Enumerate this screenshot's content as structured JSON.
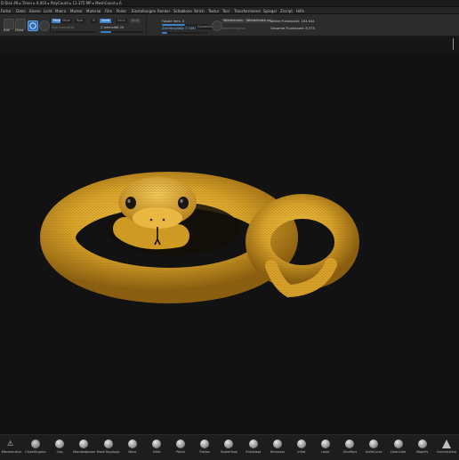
{
  "title_strip": "D Disk 49 ▸ Timer ▸ 0.003 ▸ PolyCount ▸ 13.375 MP ▸ MeshCount ▸ 6",
  "menu": [
    "Farbe",
    "Datei",
    "Ebene",
    "Licht",
    "Makro",
    "Marker",
    "Material",
    "Film",
    "Polier",
    "Einstellungen",
    "Render",
    "Schablone",
    "Strich",
    "Textur",
    "Tool",
    "Transformieren",
    "Spiegel",
    "Zscript",
    "Hilfe"
  ],
  "toolshelf": {
    "buttons": [
      {
        "label": "Edit"
      },
      {
        "label": "Draw"
      },
      {
        "label": ""
      }
    ],
    "mode_chips": {
      "mrgb": "Mrgb",
      "rgb": "Rgb",
      "m": "M",
      "zadd": "Zadd",
      "zsub": "Zsub",
      "zcut": "Zcut"
    },
    "rgb_intensity_label": "Rgb Intensität",
    "z_intensity_label": "Z Intensität 25",
    "focal_shift_label": "Fokale Vers. 0",
    "draw_size_label": "Zeichengröße 7.74939",
    "dynamic_label": "Dynamisch",
    "repeat_buttons": {
      "wiederholen": "Wiederholen",
      "wiederholen_zu": "Wiederholen zu"
    },
    "replay_hint": "Letzte Relative",
    "active_points": "Aktive Punktezahl: 163.444",
    "total_points": "Gesamte Punktezahl: 8.373",
    "z_intensity_value": 25,
    "colors": {
      "accent": "#3d82c8",
      "panel": "#2c2c2c"
    }
  },
  "brushes": [
    {
      "label": "Mikrostruktur",
      "icon": "warning-icon"
    },
    {
      "label": "ChiselOrganic",
      "icon": "organic-icon"
    },
    {
      "label": "Clay",
      "icon": "sphere-icon"
    },
    {
      "label": "Standardpinsel",
      "icon": "sphere-icon"
    },
    {
      "label": "Move Topologic",
      "icon": "sphere-icon"
    },
    {
      "label": "Move",
      "icon": "sphere-icon"
    },
    {
      "label": "Inflat",
      "icon": "sphere-icon"
    },
    {
      "label": "Polish",
      "icon": "sphere-icon"
    },
    {
      "label": "Flatten",
      "icon": "sphere-icon"
    },
    {
      "label": "SnakeHook",
      "icon": "sphere-icon"
    },
    {
      "label": "TrimAdapt",
      "icon": "sphere-icon"
    },
    {
      "label": "TrimLasso",
      "icon": "sphere-icon"
    },
    {
      "label": "Inflat",
      "icon": "sphere-icon"
    },
    {
      "label": "Layer",
      "icon": "sphere-icon"
    },
    {
      "label": "SliceRect",
      "icon": "sphere-icon"
    },
    {
      "label": "KnifeCurve",
      "icon": "sphere-icon"
    },
    {
      "label": "ClearCube",
      "icon": "sphere-icon"
    },
    {
      "label": "Magnify",
      "icon": "sphere-icon"
    },
    {
      "label": "Connecteline",
      "icon": "cone-icon"
    }
  ]
}
